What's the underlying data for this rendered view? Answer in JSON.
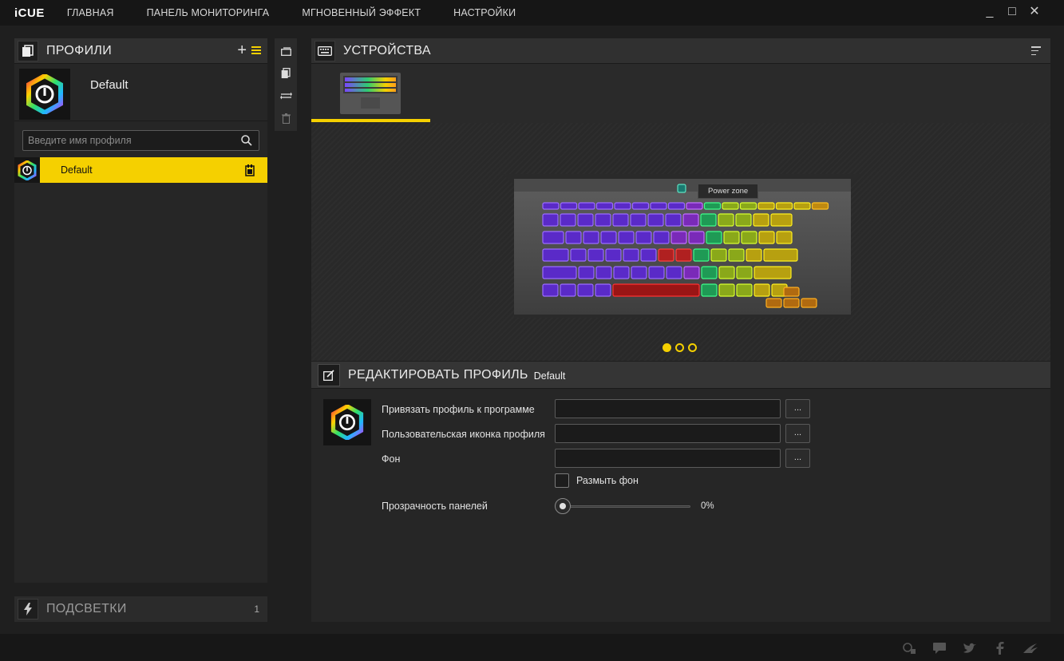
{
  "app": {
    "logo": "iCUE"
  },
  "nav": [
    "ГЛАВНАЯ",
    "ПАНЕЛЬ МОНИТОРИНГА",
    "МГНОВЕННЫЙ ЭФФЕКТ",
    "НАСТРОЙКИ"
  ],
  "window": {
    "minimize": "_",
    "maximize": "□",
    "close": "✕"
  },
  "profiles": {
    "title": "ПРОФИЛИ",
    "add": "+",
    "current_name": "Default",
    "search_placeholder": "Введите имя профиля",
    "items": [
      {
        "label": "Default",
        "selected": true
      }
    ]
  },
  "lighting": {
    "title": "ПОДСВЕТКИ",
    "count": "1"
  },
  "devices": {
    "title": "УСТРОЙСТВА",
    "tooltip": "Power zone",
    "pages": 3,
    "active_page": 1
  },
  "edit": {
    "title": "РЕДАКТИРОВАТЬ ПРОФИЛЬ",
    "profile_name": "Default",
    "fields": [
      {
        "label": "Привязать профиль к программе",
        "value": "",
        "button": "..."
      },
      {
        "label": "Пользовательская иконка профиля",
        "value": "",
        "button": "..."
      },
      {
        "label": "Фон",
        "value": "",
        "button": "..."
      }
    ],
    "blur_label": "Размыть фон",
    "opacity_label": "Прозрачность панелей",
    "opacity_value": "0%"
  },
  "colors": {
    "accent": "#f5d000",
    "panel": "#262626",
    "header": "#303030"
  }
}
